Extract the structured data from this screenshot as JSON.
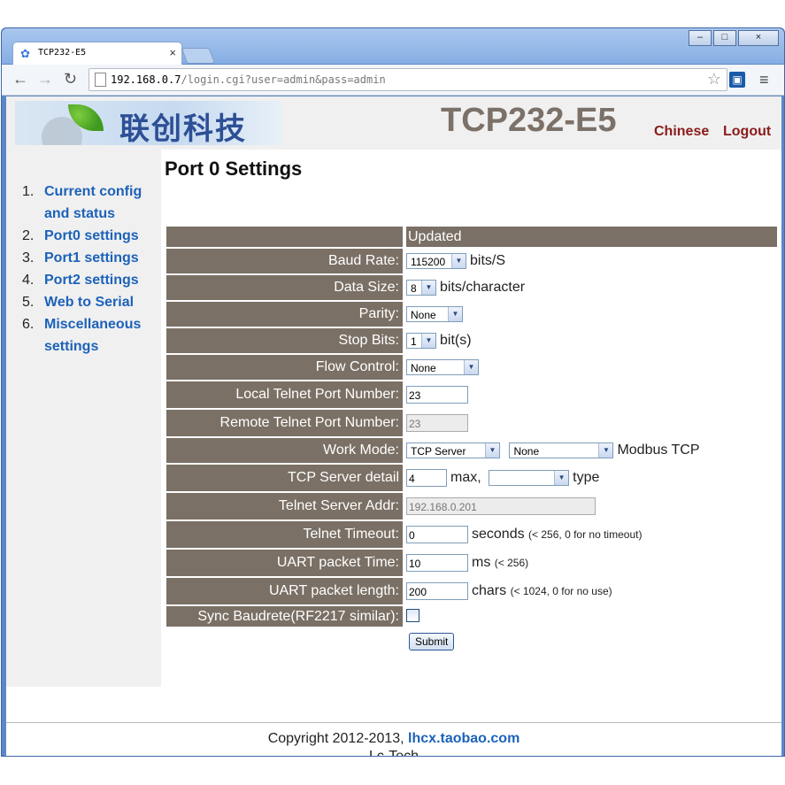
{
  "browser": {
    "tab_title": "TCP232-E5",
    "tab_close": "×",
    "url_host": "192.168.0.7",
    "url_path": "/login.cgi?user=admin&pass=admin",
    "window_min": "–",
    "window_max": "□",
    "window_close": "×"
  },
  "header": {
    "logo_text": "联创科技",
    "device_title": "TCP232-E5",
    "link_chinese": "Chinese",
    "link_logout": "Logout"
  },
  "sidebar": {
    "items": [
      {
        "num": "1.",
        "label": "Current config and status"
      },
      {
        "num": "2.",
        "label": "Port0 settings"
      },
      {
        "num": "3.",
        "label": "Port1 settings"
      },
      {
        "num": "4.",
        "label": "Port2 settings"
      },
      {
        "num": "5.",
        "label": "Web to Serial"
      },
      {
        "num": "6.",
        "label": "Miscellaneous settings"
      }
    ]
  },
  "main": {
    "title": "Port 0 Settings",
    "status": "Updated",
    "baud_label": "Baud Rate:",
    "baud_value": "115200",
    "baud_unit": "bits/S",
    "datasize_label": "Data Size:",
    "datasize_value": "8",
    "datasize_unit": "bits/character",
    "parity_label": "Parity:",
    "parity_value": "None",
    "stopbits_label": "Stop Bits:",
    "stopbits_value": "1",
    "stopbits_unit": "bit(s)",
    "flow_label": "Flow Control:",
    "flow_value": "None",
    "local_port_label": "Local Telnet Port Number:",
    "local_port_value": "23",
    "remote_port_label": "Remote Telnet Port Number:",
    "remote_port_value": "23",
    "workmode_label": "Work Mode:",
    "workmode_value": "TCP Server",
    "workmode2_value": "None",
    "workmode_suffix": "Modbus TCP",
    "tcpdetail_label": "TCP Server detail",
    "tcpdetail_value": "4",
    "tcpdetail_max": "max,",
    "tcpdetail_type_value": "",
    "tcpdetail_type": "type",
    "telnet_addr_label": "Telnet Server Addr:",
    "telnet_addr_value": "192.168.0.201",
    "timeout_label": "Telnet Timeout:",
    "timeout_value": "0",
    "timeout_unit": "seconds",
    "timeout_note": "(< 256, 0 for no timeout)",
    "uart_time_label": "UART packet Time:",
    "uart_time_value": "10",
    "uart_time_unit": "ms",
    "uart_time_note": "(< 256)",
    "uart_len_label": "UART packet length:",
    "uart_len_value": "200",
    "uart_len_unit": "chars",
    "uart_len_note": "(< 1024, 0 for no use)",
    "sync_label": "Sync Baudrete(RF2217 similar):",
    "submit_label": "Submit"
  },
  "footer": {
    "copyright": "Copyright 2012-2013,",
    "link": "lhcx.taobao.com",
    "company": "Lc-Tech"
  },
  "colors": {
    "label_bg": "#7a7065",
    "link_blue": "#1c62b9",
    "header_link": "#8b1a1a"
  }
}
